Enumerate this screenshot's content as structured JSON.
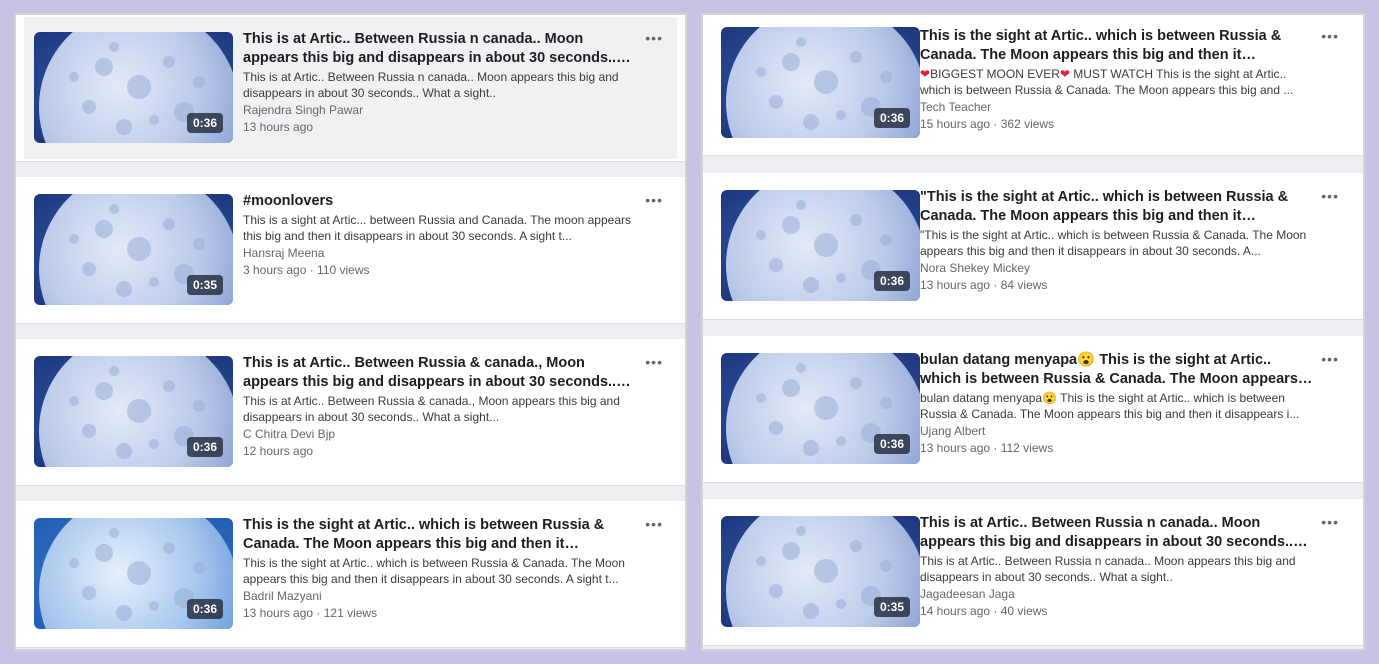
{
  "left_panel": {
    "videos": [
      {
        "title": "This is at Artic.. Between Russia n canada.. Moon appears this big and disappears in about 30 seconds.. What a sight..",
        "description": "This is at Artic.. Between Russia n canada.. Moon appears this big and disappears in about 30 seconds.. What a sight..",
        "author": "Rajendra Singh Pawar",
        "meta": "13 hours ago",
        "duration": "0:36"
      },
      {
        "title": "#moonlovers",
        "description": "This is a sight at Artic... between Russia and Canada. The moon appears this big and then it disappears in about 30 seconds. A sight t...",
        "author": "Hansraj Meena",
        "meta": "3 hours ago · 110 views",
        "duration": "0:35"
      },
      {
        "title": "This is at Artic.. Between Russia & canada., Moon appears this big and disappears in about 30 seconds.. What a sight...",
        "description": "This is at Artic.. Between Russia & canada., Moon appears this big and disappears in about 30 seconds.. What a sight...",
        "author": "C Chitra Devi Bjp",
        "meta": "12 hours ago",
        "duration": "0:36"
      },
      {
        "title": "This is the sight at Artic.. which is between Russia & Canada. The Moon appears this big and then it disappear...",
        "description": "This is the sight at Artic.. which is between Russia & Canada. The Moon appears this big and then it disappears in about 30 seconds. A sight t...",
        "author": "Badril Mazyani",
        "meta": "13 hours ago · 121 views",
        "duration": "0:36"
      }
    ]
  },
  "right_panel": {
    "videos": [
      {
        "title": "This is the sight at Artic.. which is between Russia & Canada. The Moon appears this big and then it disappear...",
        "desc_prefix": "❤",
        "desc_mid": "BIGGEST MOON EVER",
        "desc_heart2": "❤",
        "desc_rest": " MUST WATCH This is the sight at Artic.. which is between Russia & Canada. The Moon appears this big and ...",
        "author": "Tech Teacher",
        "meta": "15 hours ago · 362 views",
        "duration": "0:36"
      },
      {
        "title": "\"This is the sight at Artic.. which is between Russia & Canada. The Moon appears this big and then it disappear...",
        "description": "\"This is the sight at Artic.. which is between Russia & Canada. The Moon appears this big and then it disappears in about 30 seconds. A...",
        "author": "Nora Shekey Mickey",
        "meta": "13 hours ago · 84 views",
        "duration": "0:36"
      },
      {
        "title": "bulan datang menyapa😮 This is the sight at Artic.. which is between Russia & Canada. The Moon appears this big and...",
        "description": "bulan datang menyapa😮 This is the sight at Artic.. which is between Russia & Canada. The Moon appears this big and then it disappears i...",
        "author": "Ujang Albert",
        "meta": "13 hours ago · 112 views",
        "duration": "0:36"
      },
      {
        "title": "This is at Artic.. Between Russia n canada.. Moon appears this big and disappears in about 30 seconds.. What a sight..",
        "description": "This is at Artic.. Between Russia n canada.. Moon appears this big and disappears in about 30 seconds.. What a sight..",
        "author": "Jagadeesan Jaga",
        "meta": "14 hours ago · 40 views",
        "duration": "0:35"
      }
    ]
  },
  "more_label": "•••",
  "colors": {
    "background": "#c8c3e4",
    "card": "#ffffff",
    "moon": "#c6d3ee",
    "sky": "#1e3f8a"
  }
}
